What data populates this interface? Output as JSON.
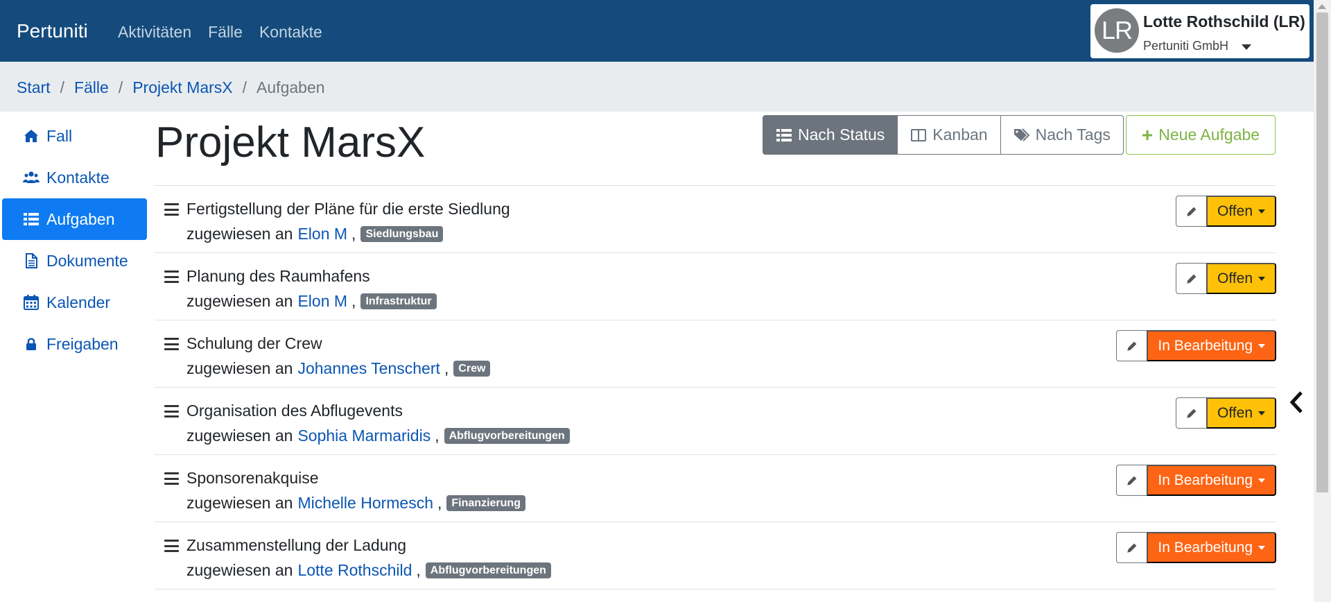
{
  "navbar": {
    "brand": "Pertuniti",
    "links": [
      "Aktivitäten",
      "Fälle",
      "Kontakte"
    ],
    "user": {
      "initials": "LR",
      "name": "Lotte Rothschild (LR)",
      "org": "Pertuniti GmbH"
    }
  },
  "breadcrumb": {
    "items": [
      "Start",
      "Fälle",
      "Projekt MarsX"
    ],
    "current": "Aufgaben"
  },
  "sidebar": {
    "items": [
      {
        "label": "Fall",
        "icon": "home-icon"
      },
      {
        "label": "Kontakte",
        "icon": "users-icon"
      },
      {
        "label": "Aufgaben",
        "icon": "list-icon",
        "active": true
      },
      {
        "label": "Dokumente",
        "icon": "file-icon"
      },
      {
        "label": "Kalender",
        "icon": "calendar-icon"
      },
      {
        "label": "Freigaben",
        "icon": "lock-icon"
      }
    ]
  },
  "main": {
    "title": "Projekt MarsX",
    "views": [
      {
        "label": "Nach Status",
        "icon": "list-icon",
        "active": true
      },
      {
        "label": "Kanban",
        "icon": "columns-icon"
      },
      {
        "label": "Nach Tags",
        "icon": "tags-icon"
      }
    ],
    "new_task_label": "Neue Aufgabe",
    "assigned_prefix": "zugewiesen an",
    "tasks": [
      {
        "title": "Fertigstellung der Pläne für die erste Siedlung",
        "assignee": "Elon M",
        "tag": "Siedlungsbau",
        "status": "Offen"
      },
      {
        "title": "Planung des Raumhafens",
        "assignee": "Elon M",
        "tag": "Infrastruktur",
        "status": "Offen"
      },
      {
        "title": "Schulung der Crew",
        "assignee": "Johannes Tenschert",
        "tag": "Crew",
        "status": "In Bearbeitung"
      },
      {
        "title": "Organisation des Abflugevents",
        "assignee": "Sophia Marmaridis",
        "tag": "Abflugvorbereitungen",
        "status": "Offen"
      },
      {
        "title": "Sponsorenakquise",
        "assignee": "Michelle Hormesch",
        "tag": "Finanzierung",
        "status": "In Bearbeitung"
      },
      {
        "title": "Zusammenstellung der Ladung",
        "assignee": "Lotte Rothschild",
        "tag": "Abflugvorbereitungen",
        "status": "In Bearbeitung"
      }
    ]
  },
  "colors": {
    "navbar": "#144b7c",
    "active": "#0e7bf2",
    "status_open": "#ffc107",
    "status_progress": "#fd6414",
    "success": "#7cb342"
  }
}
